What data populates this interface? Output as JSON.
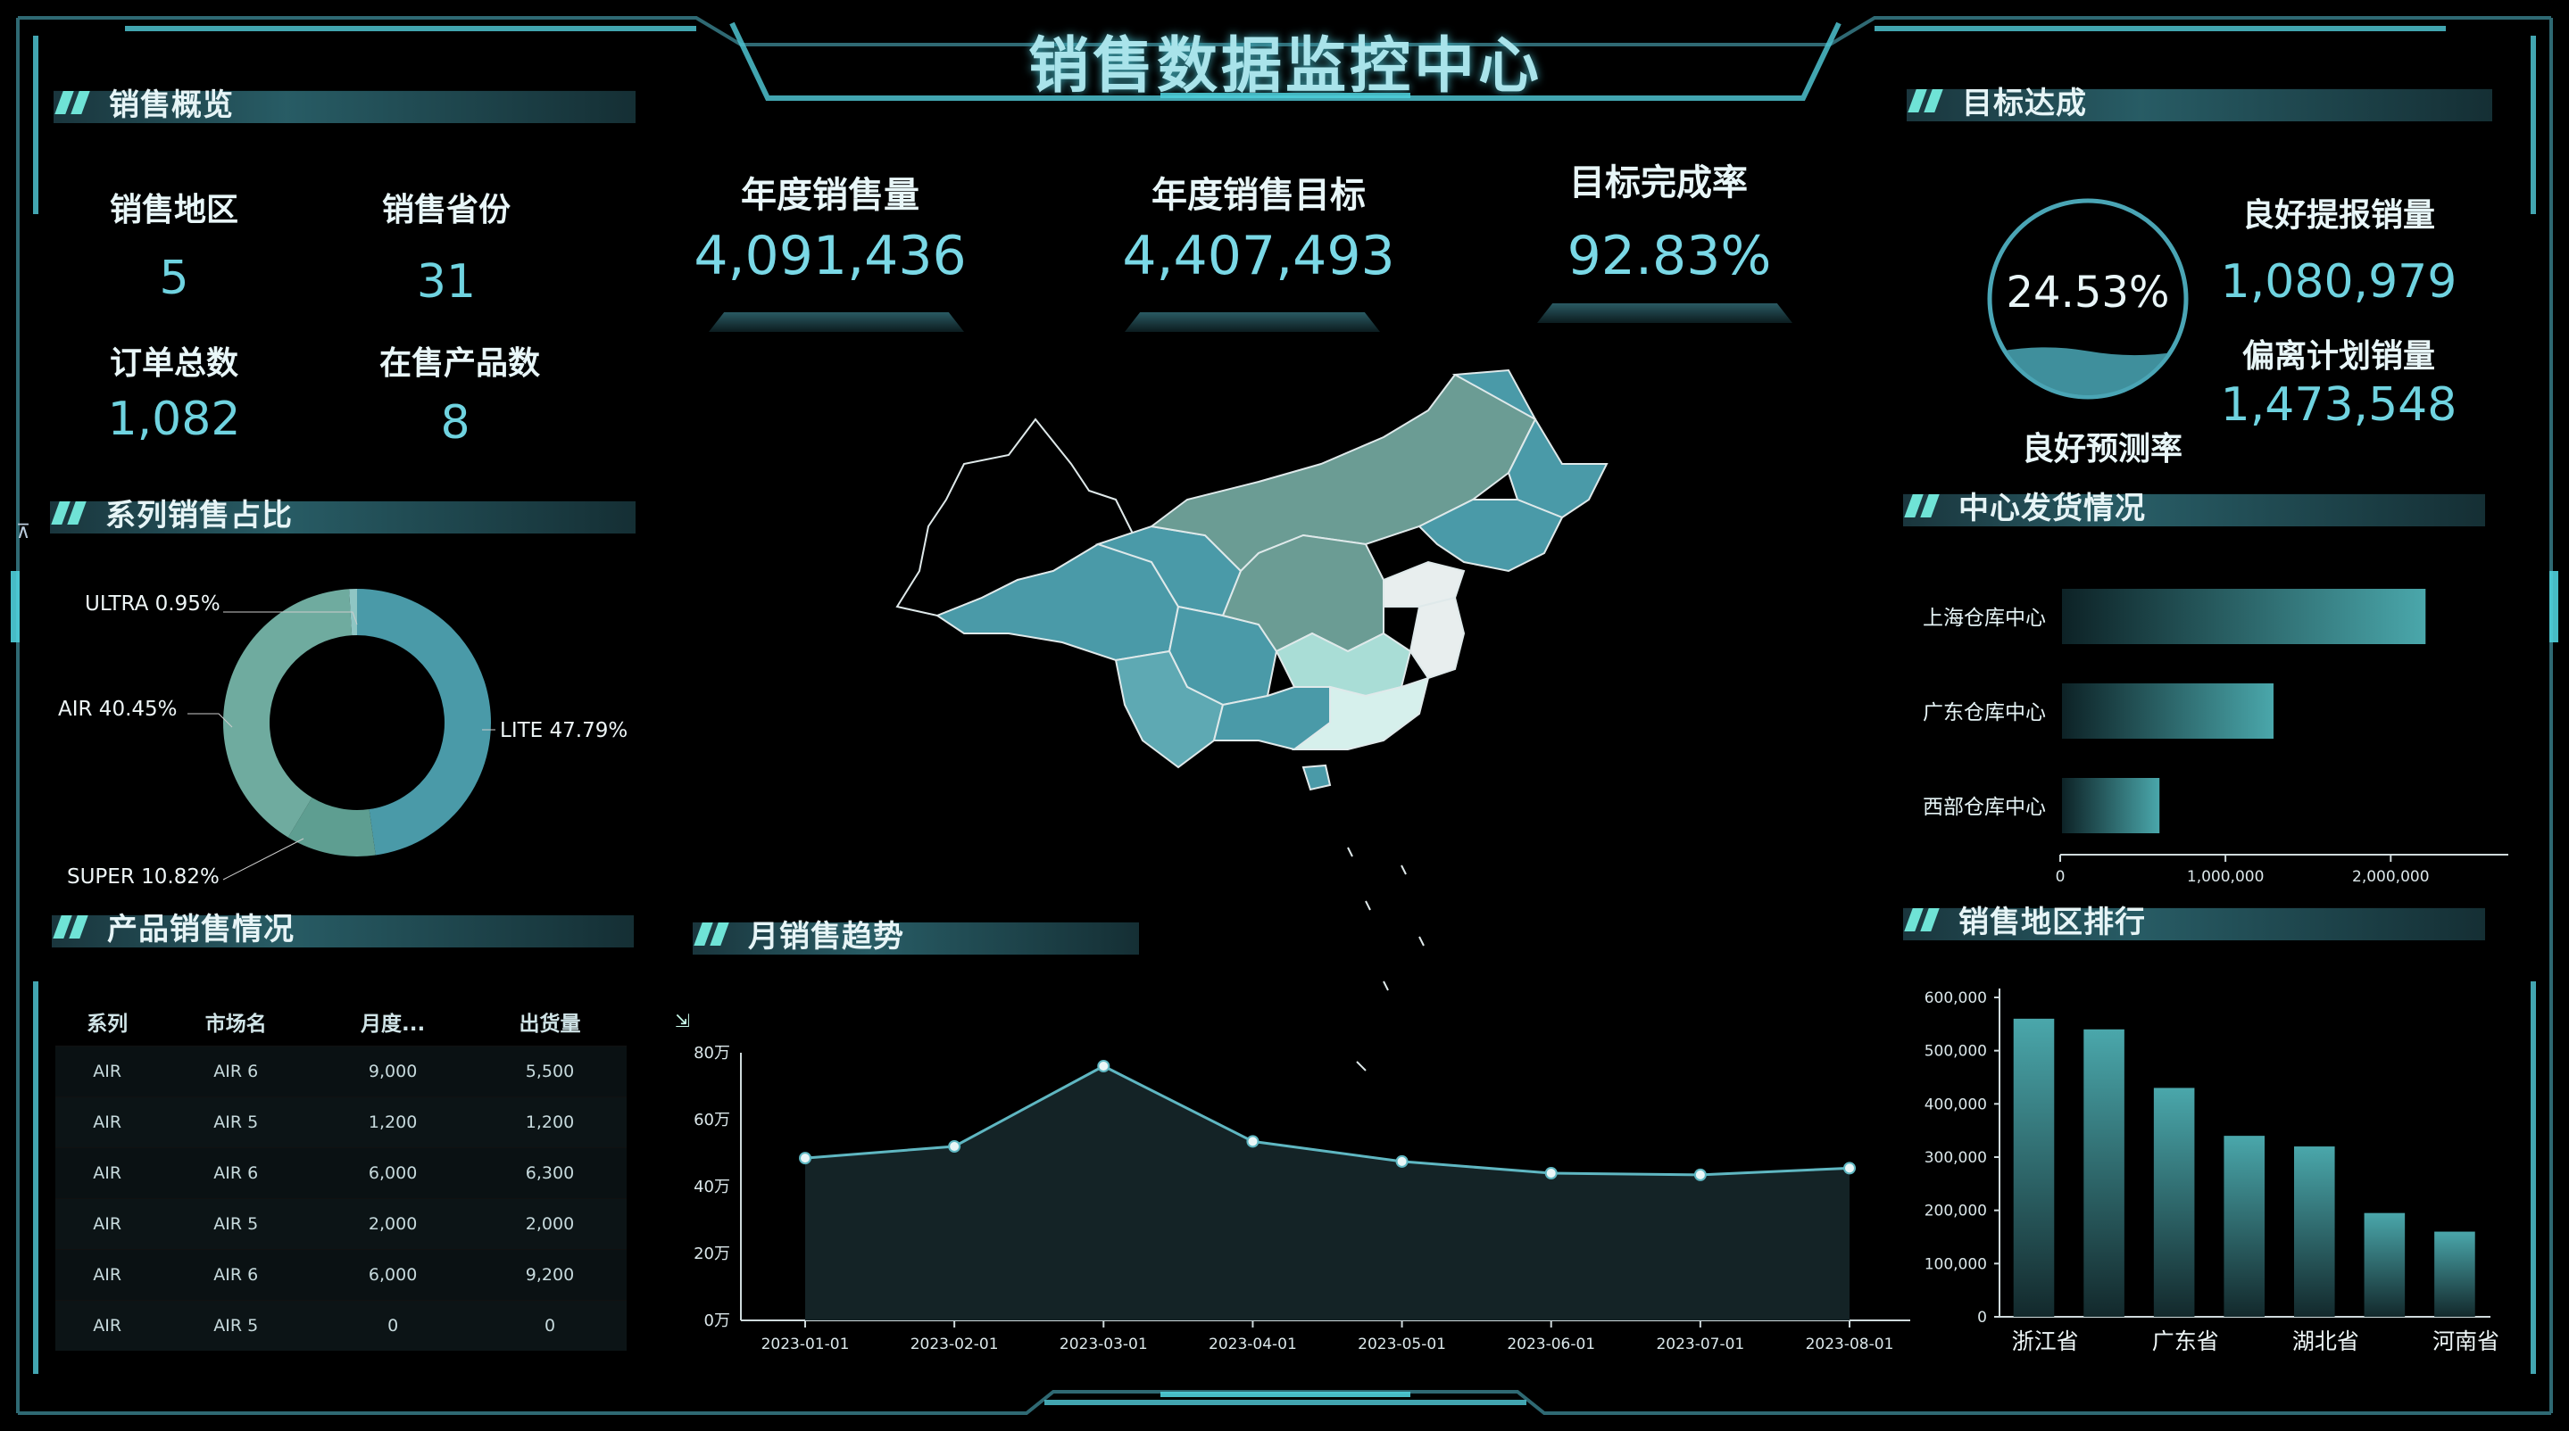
{
  "header": {
    "title": "销售数据监控中心"
  },
  "overview": {
    "title": "销售概览",
    "items": [
      {
        "label": "销售地区",
        "value": "5"
      },
      {
        "label": "销售省份",
        "value": "31"
      },
      {
        "label": "订单总数",
        "value": "1,082"
      },
      {
        "label": "在售产品数",
        "value": "8"
      }
    ]
  },
  "kpis": [
    {
      "label": "年度销售量",
      "value": "4,091,436"
    },
    {
      "label": "年度销售目标",
      "value": "4,407,493"
    },
    {
      "label": "目标完成率",
      "value": "92.83%"
    }
  ],
  "target": {
    "title": "目标达成",
    "gauge_value": "24.53%",
    "gauge_fill": 0.2453,
    "gauge_caption": "良好预测率",
    "good_label": "良好提报销量",
    "good_value": "1,080,979",
    "deviate_label": "偏离计划销量",
    "deviate_value": "1,473,548"
  },
  "series_share": {
    "title": "系列销售占比",
    "side_icon": "collapse-icon",
    "slices": [
      {
        "name": "LITE",
        "label": "LITE 47.79%",
        "value": 47.79,
        "color": "#4a9aa8"
      },
      {
        "name": "SUPER",
        "label": "SUPER 10.82%",
        "value": 10.82,
        "color": "#5e9e91"
      },
      {
        "name": "AIR",
        "label": "AIR 40.45%",
        "value": 40.45,
        "color": "#6fab9f"
      },
      {
        "name": "ULTRA",
        "label": "ULTRA 0.95%",
        "value": 0.95,
        "color": "#8fc6c4"
      }
    ]
  },
  "product_sales": {
    "title": "产品销售情况",
    "columns": [
      "系列",
      "市场名",
      "月度...",
      "出货量"
    ],
    "rows": [
      [
        "AIR",
        "AIR 6",
        "9,000",
        "5,500"
      ],
      [
        "AIR",
        "AIR 5",
        "1,200",
        "1,200"
      ],
      [
        "AIR",
        "AIR 6",
        "6,000",
        "6,300"
      ],
      [
        "AIR",
        "AIR 5",
        "2,000",
        "2,000"
      ],
      [
        "AIR",
        "AIR 6",
        "6,000",
        "9,200"
      ],
      [
        "AIR",
        "AIR 5",
        "0",
        "0"
      ]
    ]
  },
  "monthly": {
    "title": "月销售趋势",
    "icon": "export-icon"
  },
  "shipping": {
    "title": "中心发货情况",
    "bars": [
      {
        "label": "上海仓库中心",
        "value": 2200000
      },
      {
        "label": "广东仓库中心",
        "value": 1280000
      },
      {
        "label": "西部仓库中心",
        "value": 590000
      }
    ],
    "ticks": [
      "0",
      "1,000,000",
      "2,000,000"
    ],
    "max": 2800000
  },
  "region_rank": {
    "title": "销售地区排行"
  },
  "chart_data": [
    {
      "type": "line",
      "x": [
        "2023-01-01",
        "2023-02-01",
        "2023-03-01",
        "2023-04-01",
        "2023-05-01",
        "2023-06-01",
        "2023-07-01",
        "2023-08-01"
      ],
      "values": [
        485000,
        520000,
        760000,
        535000,
        475000,
        440000,
        435000,
        455000
      ],
      "yticks": [
        "0万",
        "20万",
        "40万",
        "60万",
        "80万"
      ],
      "ylim": [
        0,
        800000
      ],
      "color": "#5fb7c2"
    },
    {
      "type": "bar",
      "categories": [
        "浙江省",
        "",
        "广东省",
        "",
        "湖北省",
        "",
        "河南省"
      ],
      "values": [
        560000,
        540000,
        430000,
        340000,
        320000,
        195000,
        160000
      ],
      "yticks": [
        "0",
        "100,000",
        "200,000",
        "300,000",
        "400,000",
        "500,000",
        "600,000"
      ],
      "ylim": [
        0,
        600000
      ],
      "color": "#4fa9ad"
    }
  ]
}
